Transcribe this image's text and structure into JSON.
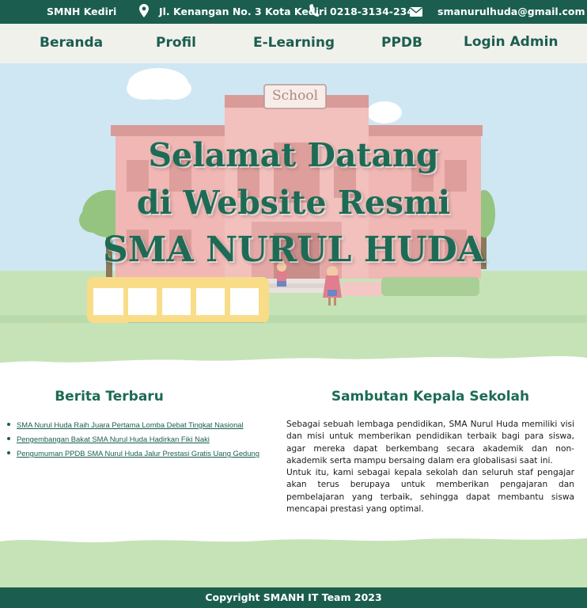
{
  "topbar": {
    "school_name": "SMNH Kediri",
    "address": "Jl. Kenangan No. 3 Kota Kediri",
    "phone": "0218-3134-234",
    "email": "smanurulhuda@gmail.com",
    "address_icon": "location-pin-icon",
    "phone_icon": "phone-icon",
    "email_icon": "envelope-icon"
  },
  "nav": {
    "items": [
      {
        "label": "Beranda"
      },
      {
        "label": "Profil"
      },
      {
        "label": "E-Learning"
      },
      {
        "label": "PPDB"
      },
      {
        "label": "Login Admin"
      }
    ]
  },
  "hero": {
    "school_sign": "School",
    "title_line1": "Selamat Datang",
    "title_line2": "di Website Resmi",
    "title_line3": "SMA NURUL HUDA"
  },
  "news": {
    "heading": "Berita Terbaru",
    "items": [
      "SMA Nurul Huda Raih Juara Pertama Lomba Debat Tingkat Nasional",
      "Pengembangan Bakat SMA Nurul Huda Hadirkan Fiki Naki",
      "Pengumuman PPDB SMA Nurul Huda Jalur Prestasi Gratis Uang Gedung"
    ]
  },
  "welcome": {
    "heading": "Sambutan Kepala Sekolah",
    "paragraph1": "Sebagai sebuah lembaga pendidikan, SMA Nurul Huda memiliki visi dan misi untuk memberikan pendidikan terbaik bagi para siswa, agar mereka dapat berkembang secara akademik dan non-akademik serta mampu bersaing dalam era globalisasi saat ini.",
    "paragraph2": "Untuk itu, kami sebagai kepala sekolah dan seluruh staf pengajar akan terus berupaya untuk memberikan pengajaran dan pembelajaran yang terbaik, sehingga dapat membantu siswa mencapai prestasi yang optimal."
  },
  "footer": {
    "copyright": "Copyright SMANH IT Team 2023"
  },
  "colors": {
    "primary": "#1b5e4f",
    "heading_green": "#1d6b55",
    "nav_bg": "#f1f1ec",
    "sky": "#cde6f2",
    "grass": "#c6e3b8",
    "building": "#f0b7b4"
  }
}
